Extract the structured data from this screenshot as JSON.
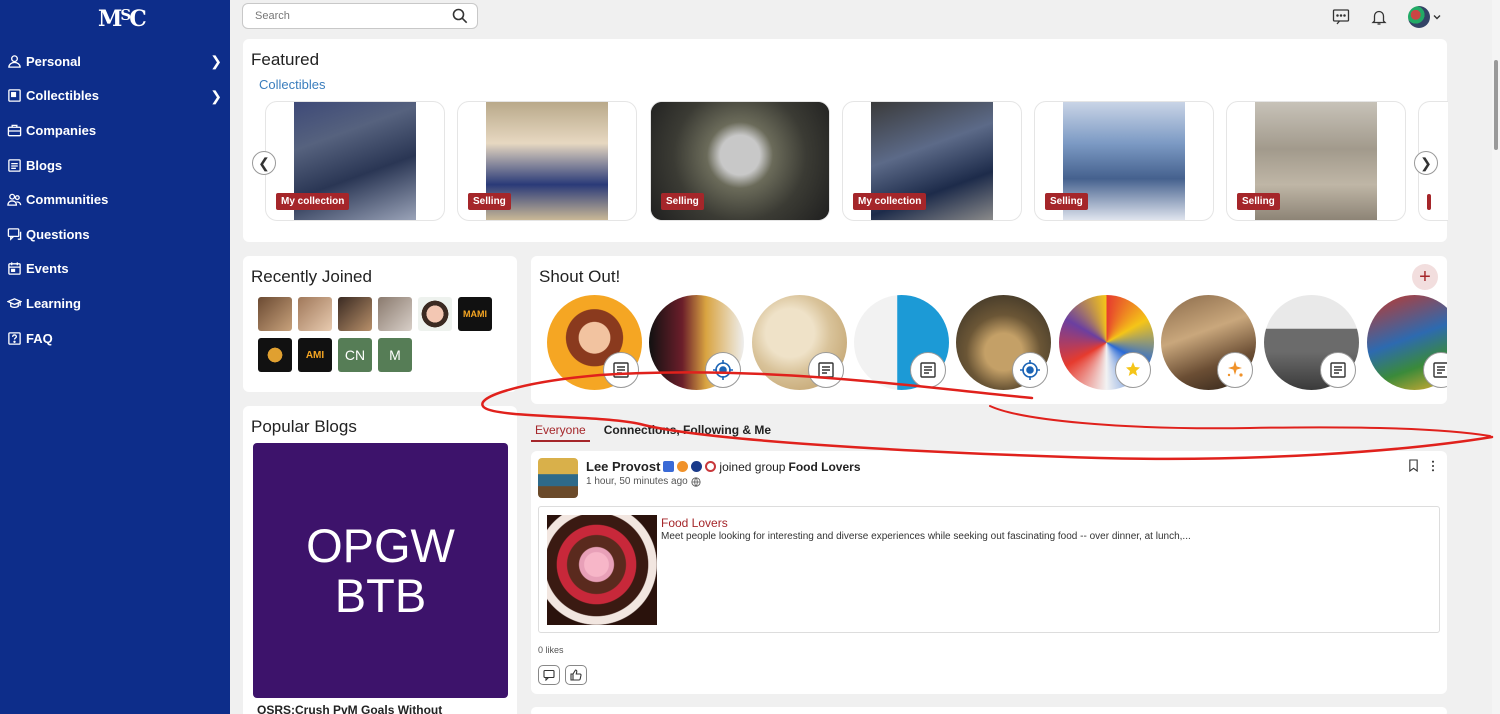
{
  "app": {
    "logo": "MSC"
  },
  "sidebar": {
    "items": [
      {
        "label": "Personal",
        "icon": "person-icon",
        "chevron": true
      },
      {
        "label": "Collectibles",
        "icon": "collectibles-icon",
        "chevron": true
      },
      {
        "label": "Companies",
        "icon": "briefcase-icon",
        "chevron": false
      },
      {
        "label": "Blogs",
        "icon": "blog-icon",
        "chevron": false
      },
      {
        "label": "Communities",
        "icon": "people-icon",
        "chevron": false
      },
      {
        "label": "Questions",
        "icon": "question-chat-icon",
        "chevron": false
      },
      {
        "label": "Events",
        "icon": "calendar-icon",
        "chevron": false
      },
      {
        "label": "Learning",
        "icon": "graduation-cap-icon",
        "chevron": false
      },
      {
        "label": "FAQ",
        "icon": "faq-icon",
        "chevron": false
      }
    ]
  },
  "header": {
    "search_placeholder": "Search",
    "icons": [
      "messages-icon",
      "bell-icon",
      "avatar",
      "chevron-down-icon"
    ]
  },
  "featured": {
    "title": "Featured",
    "subtitle": "Collectibles",
    "cards": [
      {
        "badge": "My collection"
      },
      {
        "badge": "Selling"
      },
      {
        "badge": "Selling"
      },
      {
        "badge": "My collection"
      },
      {
        "badge": "Selling"
      },
      {
        "badge": "Selling"
      },
      {
        "badge": ""
      }
    ]
  },
  "recently_joined": {
    "title": "Recently Joined",
    "members": [
      "",
      "",
      "",
      "",
      "",
      "",
      "",
      "",
      "CN",
      "M"
    ]
  },
  "shout_out": {
    "title": "Shout Out!",
    "add_label": "+",
    "items": [
      {
        "badge_icon": "notes-icon"
      },
      {
        "badge_icon": "target-icon"
      },
      {
        "badge_icon": "notes-icon"
      },
      {
        "badge_icon": "notes-icon"
      },
      {
        "badge_icon": "target-icon"
      },
      {
        "badge_icon": "stars-icon"
      },
      {
        "badge_icon": "sparkle-icon"
      },
      {
        "badge_icon": "notes-icon"
      },
      {
        "badge_icon": "notes-icon"
      }
    ]
  },
  "popular_blogs": {
    "title": "Popular Blogs",
    "image_text": "OPGW\nBTB",
    "caption": "OSRS:Crush PvM Goals Without"
  },
  "feed": {
    "tabs": [
      {
        "label": "Everyone",
        "active": true
      },
      {
        "label": "Connections, Following & Me",
        "active": false
      }
    ],
    "post": {
      "author": "Lee Provost",
      "action": "joined group",
      "target": "Food Lovers",
      "time": "1 hour, 50 minutes ago",
      "embed_title": "Food Lovers",
      "embed_description": "Meet people looking for interesting and diverse experiences while seeking out fascinating food -- over dinner, at lunch,...",
      "likes": "0 likes"
    }
  },
  "colors": {
    "sidebar": "#0d2d8a",
    "accent": "#a5262a",
    "link": "#3a7dbd",
    "blog_bg": "#3d136b"
  }
}
